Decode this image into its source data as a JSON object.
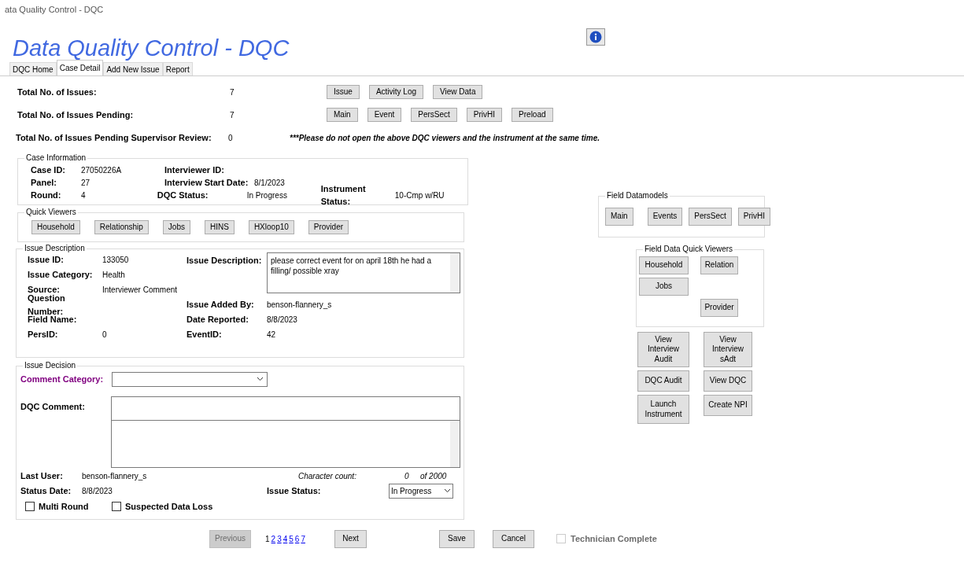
{
  "window": {
    "title": "ata Quality Control - DQC"
  },
  "header": {
    "title": "Data Quality Control - DQC"
  },
  "tabs": [
    {
      "label": "DQC Home",
      "selected": false
    },
    {
      "label": "Case Detail",
      "selected": true
    },
    {
      "label": "Add New Issue",
      "selected": false
    },
    {
      "label": "Report",
      "selected": false
    }
  ],
  "summary": [
    {
      "label": "Total No. of Issues:",
      "value": "7"
    },
    {
      "label": "Total No. of Issues Pending:",
      "value": "7"
    },
    {
      "label": "Total No. of Issues Pending Supervisor Review:",
      "value": "0"
    }
  ],
  "viewer_buttons": [
    [
      "Issue",
      "Activity Log",
      "View Data"
    ],
    [
      "Main",
      "Event",
      "PersSect",
      "PrivHI",
      "Preload"
    ]
  ],
  "notice": "***Please do not open the above DQC viewers and the instrument at the same time.",
  "case_information": {
    "title": "Case Information",
    "rows": [
      [
        {
          "label": "Case ID:",
          "value": "27050226A"
        },
        {
          "label": "Interviewer ID:"
        }
      ],
      [
        {
          "label": "Panel:",
          "value": "27"
        },
        {
          "label": "Interview Start Date:",
          "value": "8/1/2023"
        }
      ],
      [
        {
          "label": "Round:",
          "value": "4"
        },
        {
          "label": "DQC Status:",
          "value": "In Progress"
        },
        {
          "label": "Instrument Status:",
          "value": "10-Cmp w/RU"
        }
      ]
    ]
  },
  "quick_viewers": {
    "title": "Quick Viewers",
    "buttons": [
      "Household",
      "Relationship",
      "Jobs",
      "HINS",
      "HXloop10",
      "Provider"
    ]
  },
  "issue_description": {
    "title": "Issue Description",
    "id_fields": [
      {
        "label": "Issue ID:",
        "value": "133050"
      },
      {
        "label": "Issue Category:",
        "value": "Health"
      },
      {
        "label": "Source:",
        "value": "Interviewer Comment"
      },
      {
        "label": "Question Number:"
      },
      {
        "label": "Field Name:"
      },
      {
        "label": "PersID:",
        "value": "0"
      }
    ],
    "description": {
      "label": "Issue Description:",
      "text": "please correct event for on april 18th he had a filling/ possible xray"
    },
    "detail_fields": [
      {
        "label": "Issue Added By:",
        "value": "benson-flannery_s"
      },
      {
        "label": "Date Reported:",
        "value": "8/8/2023"
      },
      {
        "label": "EventID:",
        "value": "42"
      }
    ]
  },
  "issue_decision": {
    "title": "Issue Decision",
    "comment_category": {
      "label": "Comment Category:"
    },
    "dqc_comment": {
      "label": "DQC Comment:"
    },
    "last_user": {
      "label": "Last User:",
      "value": "benson-flannery_s"
    },
    "character_count": {
      "label": "Character count:",
      "count": "0",
      "max": "of 2000"
    },
    "status_date": {
      "label": "Status Date:",
      "value": "8/8/2023"
    },
    "issue_status": {
      "label": "Issue Status:",
      "value": "In Progress"
    },
    "checkboxes": [
      {
        "label": "Multi Round",
        "checked": false
      },
      {
        "label": "Suspected Data Loss",
        "checked": false
      }
    ]
  },
  "field_datamodels": {
    "title": "Field Datamodels",
    "buttons": [
      "Main",
      "Events",
      "PersSect",
      "PrivHI"
    ]
  },
  "field_data_quick_viewers": {
    "title": "Field Data Quick Viewers",
    "buttons": [
      "Household",
      "Relation",
      "Jobs",
      "Provider"
    ]
  },
  "actions": [
    "View Interview Audit",
    "View Interview sAdt",
    "DQC Audit",
    "View DQC",
    "Launch Instrument",
    "Create NPI"
  ],
  "pager": {
    "previous": {
      "label": "Previous",
      "disabled": true
    },
    "pages": [
      {
        "label": "1",
        "selected": true
      },
      {
        "label": "2",
        "selected": false
      },
      {
        "label": "3",
        "selected": false
      },
      {
        "label": "4",
        "selected": false
      },
      {
        "label": "5",
        "selected": false
      },
      {
        "label": "6",
        "selected": false
      },
      {
        "label": "7",
        "selected": false
      }
    ],
    "next": {
      "label": "Next",
      "disabled": false
    }
  },
  "save": "Save",
  "cancel": "Cancel",
  "technician_complete": {
    "label": "Technician Complete",
    "checked": false,
    "disabled": true
  }
}
